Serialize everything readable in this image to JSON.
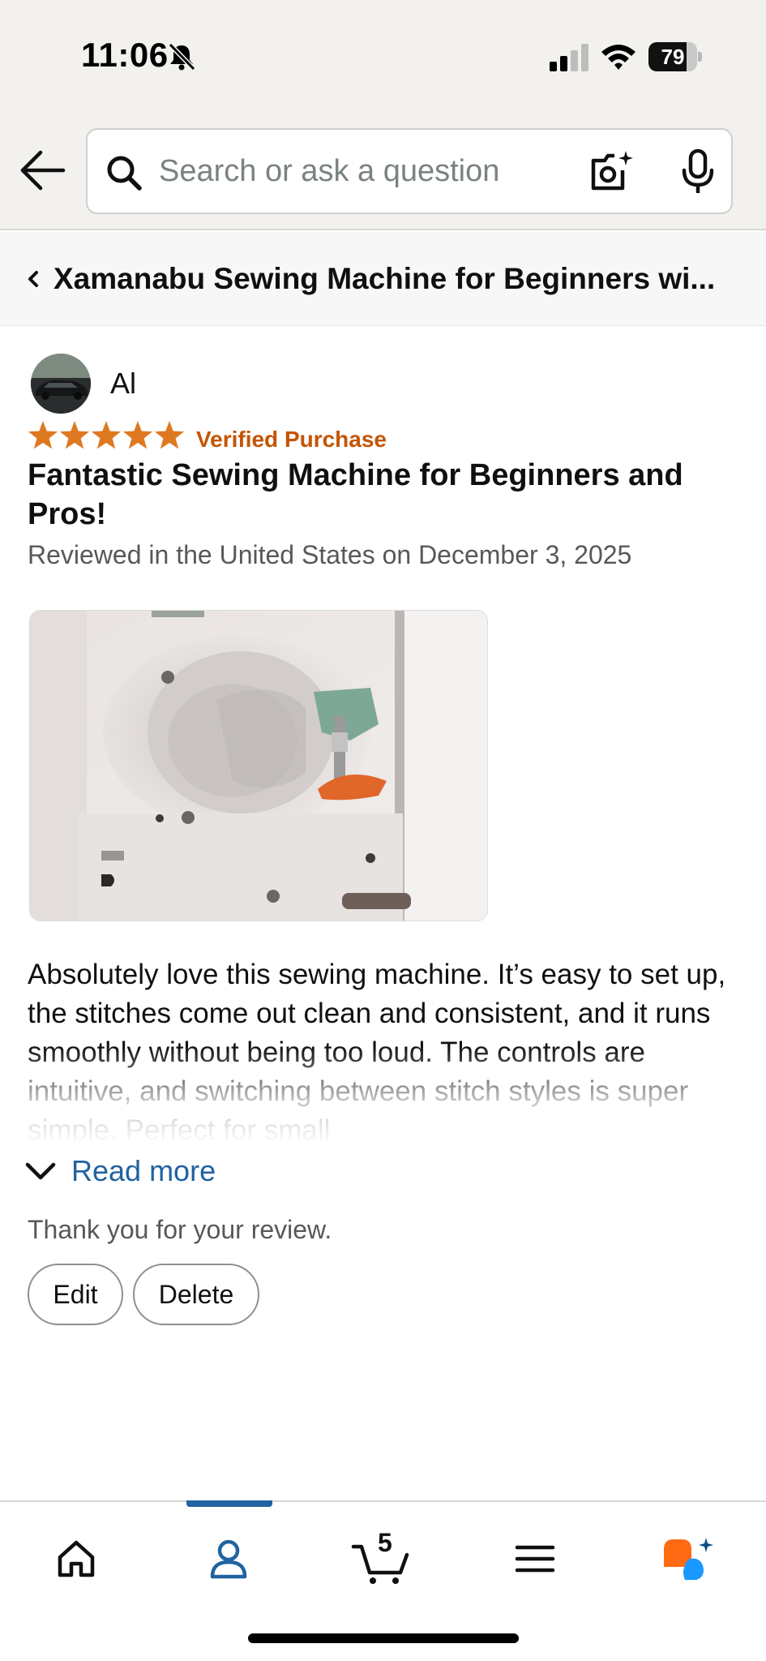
{
  "status_bar": {
    "time": "11:06",
    "battery": "79",
    "battery_level": 0.79
  },
  "header": {
    "search_placeholder": "Search or ask a question"
  },
  "product": {
    "title": "Xamanabu Sewing Machine for Beginners wi..."
  },
  "review": {
    "reviewer_name": "Al",
    "rating": 5,
    "rating_max": 5,
    "verified_label": "Verified Purchase",
    "title": "Fantastic Sewing Machine for Beginners and Pros!",
    "meta": "Reviewed in the United States on December 3, 2025",
    "body": "Absolutely love this sewing machine. It’s easy to set up, the stitches come out clean and consistent, and it runs smoothly without being too loud. The controls are intuitive, and switching between stitch styles is super simple. Perfect for small",
    "read_more": "Read more",
    "thanks": "Thank you for your review.",
    "edit_label": "Edit",
    "delete_label": "Delete"
  },
  "bottom_nav": {
    "items": [
      "home-icon",
      "you-icon",
      "cart-icon",
      "menu-icon",
      "rufus-icon"
    ],
    "active": "you-icon",
    "cart_count": "5"
  },
  "colors": {
    "accent": "#2162a1",
    "star": "#de7921",
    "verified": "#c45500",
    "header_bg": "#f2f1ee",
    "rufus_orange": "#ff6a13",
    "rufus_blue": "#1a98ff"
  }
}
